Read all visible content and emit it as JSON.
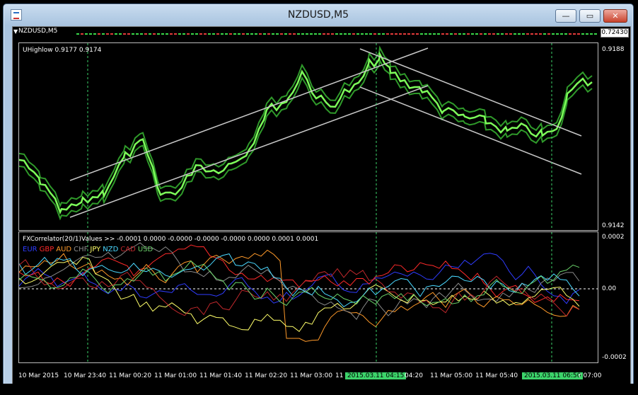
{
  "window": {
    "title": "NZDUSD,M5"
  },
  "window_buttons": {
    "minimize": "—",
    "maximize": "▭",
    "close": "✕"
  },
  "chart_header": {
    "symbol_label": "NZDUSD,M5",
    "current_price": "0.72430"
  },
  "main_pane": {
    "indicator_label": "UHighlow 0.9177 0.9174",
    "scale_top": "0.9188",
    "scale_bottom": "0.9142"
  },
  "indicator_pane": {
    "label": "FXCorrelator(20/1)Values >> -0.0001 0.0000 -0.0000 -0.0000 -0.0000 0.0000 0.0001 0.0001",
    "legend": [
      {
        "name": "EUR",
        "color": "#2f3cff"
      },
      {
        "name": "GBP",
        "color": "#ff2a2a"
      },
      {
        "name": "AUD",
        "color": "#ff9a2a"
      },
      {
        "name": "CHF",
        "color": "#8a8a8a"
      },
      {
        "name": "JPY",
        "color": "#ffff6a"
      },
      {
        "name": "NZD",
        "color": "#4ad8ff"
      },
      {
        "name": "CAD",
        "color": "#c0282c"
      },
      {
        "name": "USD",
        "color": "#6ad26a"
      }
    ],
    "scale_top": "0.0002",
    "scale_zero": "0.00",
    "scale_bottom": "-0.0002"
  },
  "time_axis": {
    "labels": [
      "10 Mar 2015",
      "10 Mar 23:40",
      "11 Mar 00:20",
      "11 Mar 01:00",
      "11 Mar 01:40",
      "11 Mar 02:20",
      "11 Mar 03:00",
      "11",
      "04:20",
      "11 Mar 05:00",
      "11 Mar 05:40",
      "r 07:00"
    ],
    "crosshair_badges": [
      "2015.03.11 04:15",
      "2015.03.11 06:50"
    ]
  },
  "colors": {
    "price_line": "#7dff5a",
    "envelope": "#2f9a2a",
    "trend_lines": "#c8c8c8",
    "crosshair": "#3cd36a"
  }
}
